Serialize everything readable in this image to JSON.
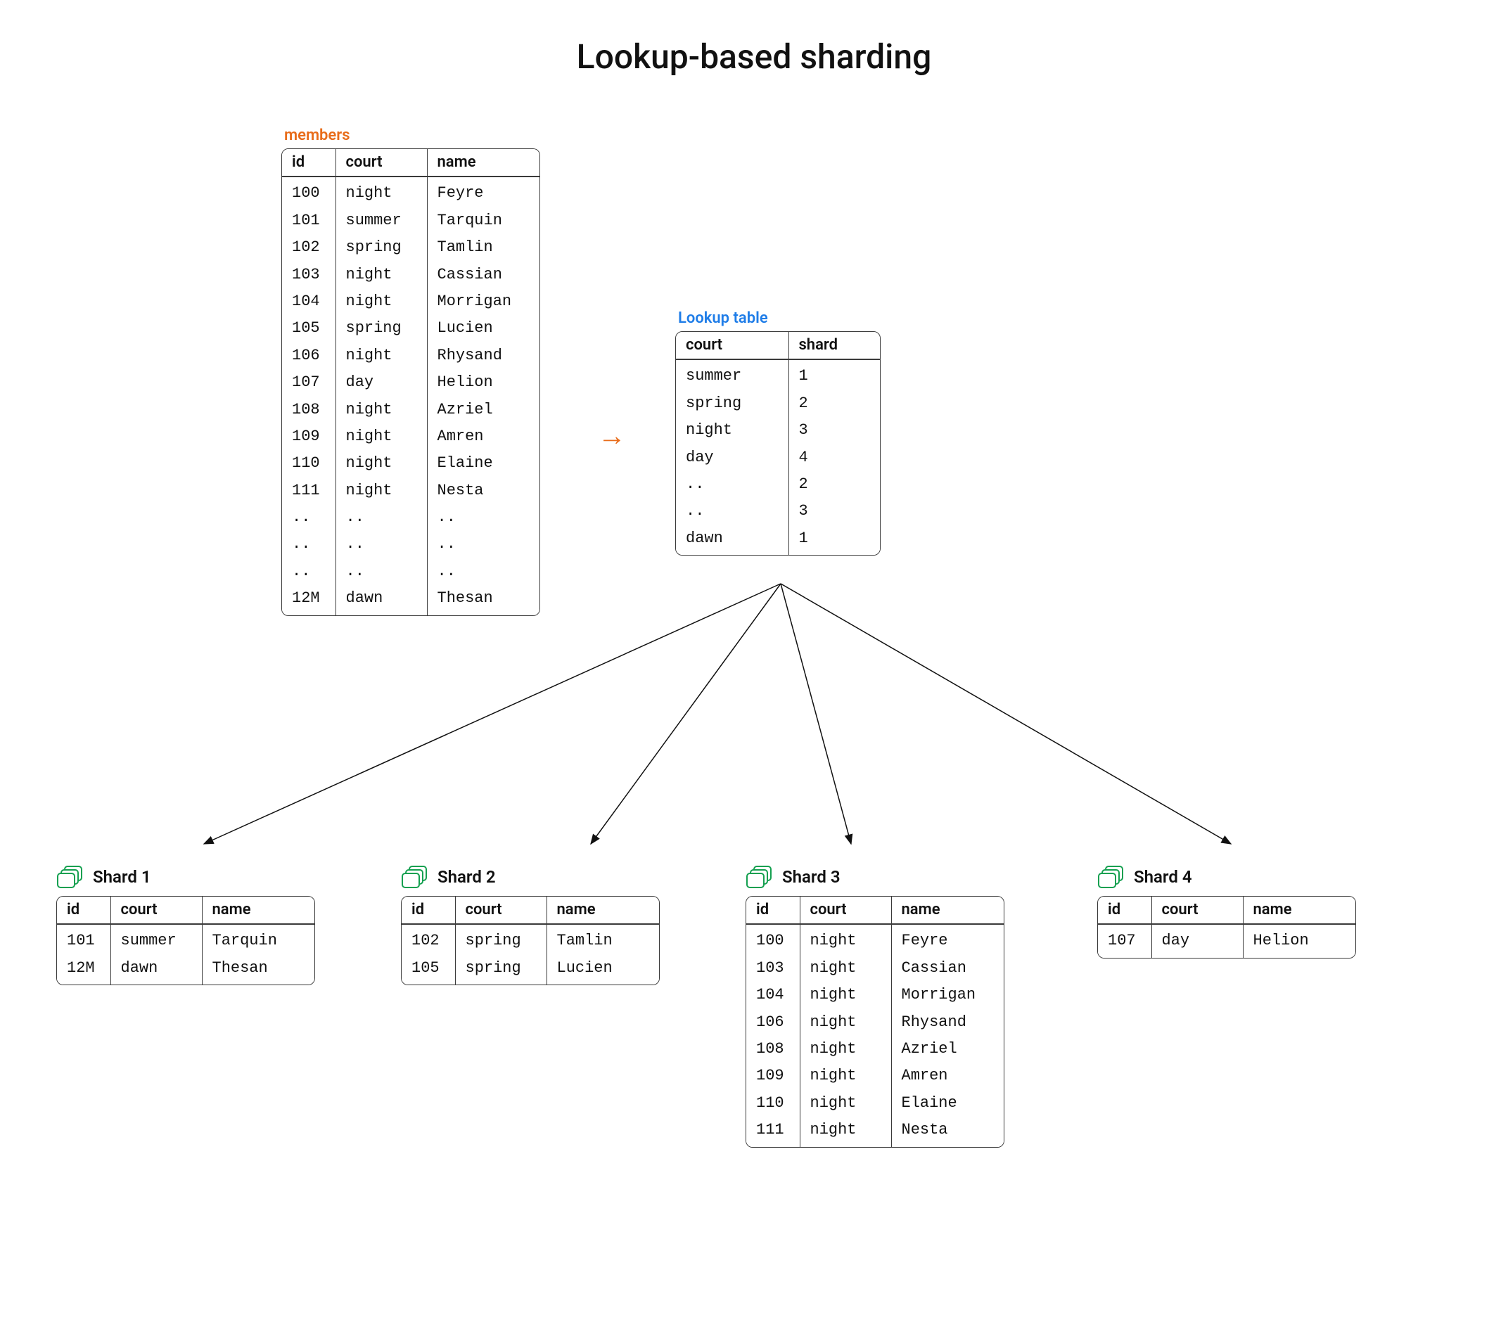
{
  "title": "Lookup-based sharding",
  "members": {
    "label": "members",
    "headers": {
      "id": "id",
      "court": "court",
      "name": "name"
    },
    "rows": [
      {
        "id": "100",
        "court": "night",
        "name": "Feyre"
      },
      {
        "id": "101",
        "court": "summer",
        "name": "Tarquin"
      },
      {
        "id": "102",
        "court": "spring",
        "name": "Tamlin"
      },
      {
        "id": "103",
        "court": "night",
        "name": "Cassian"
      },
      {
        "id": "104",
        "court": "night",
        "name": "Morrigan"
      },
      {
        "id": "105",
        "court": "spring",
        "name": "Lucien"
      },
      {
        "id": "106",
        "court": "night",
        "name": "Rhysand"
      },
      {
        "id": "107",
        "court": "day",
        "name": "Helion"
      },
      {
        "id": "108",
        "court": "night",
        "name": "Azriel"
      },
      {
        "id": "109",
        "court": "night",
        "name": "Amren"
      },
      {
        "id": "110",
        "court": "night",
        "name": "Elaine"
      },
      {
        "id": "111",
        "court": "night",
        "name": "Nesta"
      },
      {
        "id": "..",
        "court": "..",
        "name": ".."
      },
      {
        "id": "..",
        "court": "..",
        "name": ".."
      },
      {
        "id": "..",
        "court": "..",
        "name": ".."
      },
      {
        "id": "12M",
        "court": "dawn",
        "name": "Thesan"
      }
    ]
  },
  "lookup": {
    "label": "Lookup table",
    "headers": {
      "court": "court",
      "shard": "shard"
    },
    "rows": [
      {
        "court": "summer",
        "shard": "1"
      },
      {
        "court": "spring",
        "shard": "2"
      },
      {
        "court": "night",
        "shard": "3"
      },
      {
        "court": "day",
        "shard": "4"
      },
      {
        "court": "..",
        "shard": "2"
      },
      {
        "court": "..",
        "shard": "3"
      },
      {
        "court": "dawn",
        "shard": "1"
      }
    ]
  },
  "shards": [
    {
      "label": "Shard 1",
      "headers": {
        "id": "id",
        "court": "court",
        "name": "name"
      },
      "rows": [
        {
          "id": "101",
          "court": "summer",
          "name": "Tarquin"
        },
        {
          "id": "12M",
          "court": "dawn",
          "name": "Thesan"
        }
      ]
    },
    {
      "label": "Shard 2",
      "headers": {
        "id": "id",
        "court": "court",
        "name": "name"
      },
      "rows": [
        {
          "id": "102",
          "court": "spring",
          "name": "Tamlin"
        },
        {
          "id": "105",
          "court": "spring",
          "name": "Lucien"
        }
      ]
    },
    {
      "label": "Shard 3",
      "headers": {
        "id": "id",
        "court": "court",
        "name": "name"
      },
      "rows": [
        {
          "id": "100",
          "court": "night",
          "name": "Feyre"
        },
        {
          "id": "103",
          "court": "night",
          "name": "Cassian"
        },
        {
          "id": "104",
          "court": "night",
          "name": "Morrigan"
        },
        {
          "id": "106",
          "court": "night",
          "name": "Rhysand"
        },
        {
          "id": "108",
          "court": "night",
          "name": "Azriel"
        },
        {
          "id": "109",
          "court": "night",
          "name": "Amren"
        },
        {
          "id": "110",
          "court": "night",
          "name": "Elaine"
        },
        {
          "id": "111",
          "court": "night",
          "name": "Nesta"
        }
      ]
    },
    {
      "label": "Shard 4",
      "headers": {
        "id": "id",
        "court": "court",
        "name": "name"
      },
      "rows": [
        {
          "id": "107",
          "court": "day",
          "name": "Helion"
        }
      ]
    }
  ],
  "icons": {
    "arrow_right": "→"
  },
  "colors": {
    "orange": "#e86c1a",
    "blue": "#1f7de8",
    "green": "#15a050",
    "border": "#3a3a3a"
  }
}
